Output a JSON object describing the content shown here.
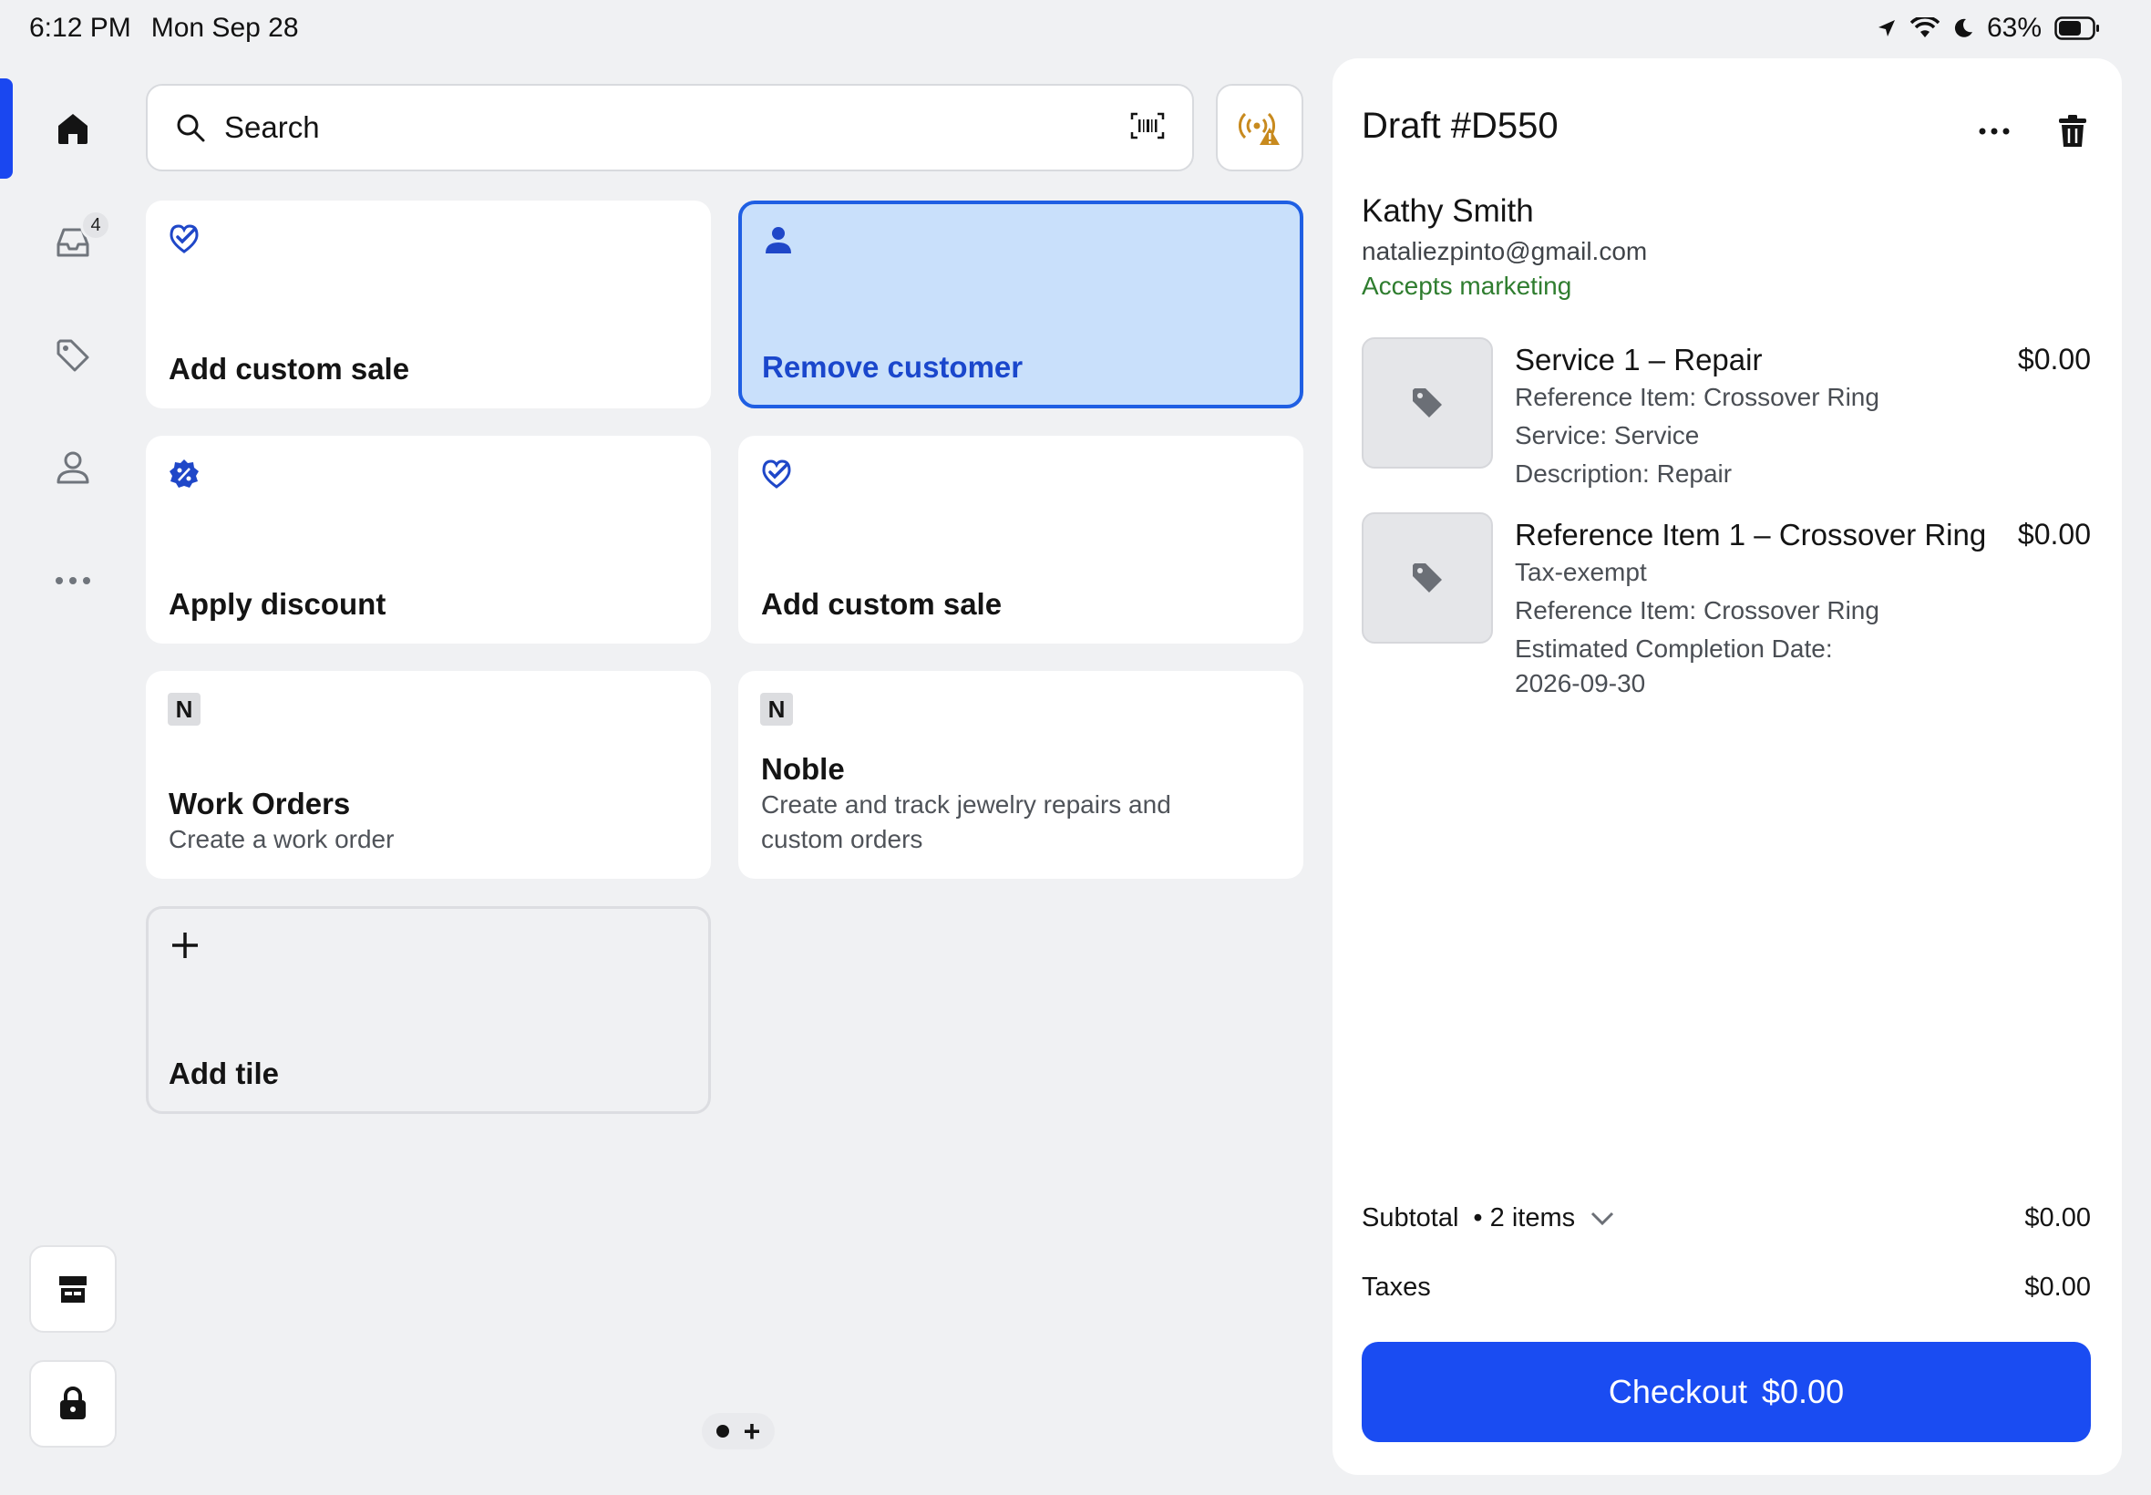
{
  "status": {
    "time": "6:12 PM",
    "date": "Mon Sep 28",
    "battery": "63%"
  },
  "nav": {
    "inbox_badge": "4"
  },
  "search": {
    "placeholder": "Search"
  },
  "tiles": {
    "t1": {
      "title": "Add custom sale"
    },
    "t2": {
      "title": "Remove customer"
    },
    "t3": {
      "title": "Apply discount"
    },
    "t4": {
      "title": "Add custom sale"
    },
    "t5": {
      "badge": "N",
      "title": "Work Orders",
      "subtitle": "Create a work order"
    },
    "t6": {
      "badge": "N",
      "title": "Noble",
      "subtitle": "Create and track jewelry repairs and custom orders"
    },
    "t7": {
      "title": "Add tile"
    }
  },
  "pager": {
    "add": "+"
  },
  "draft": {
    "title": "Draft #D550",
    "customer": {
      "name": "Kathy Smith",
      "email": "nataliezpinto@gmail.com",
      "marketing": "Accepts marketing"
    },
    "items": [
      {
        "name": "Service 1 – Repair",
        "price": "$0.00",
        "details": [
          "Reference Item: Crossover Ring",
          "Service: Service",
          "Description: Repair"
        ]
      },
      {
        "name": "Reference Item 1 – Crossover Ring",
        "price": "$0.00",
        "details": [
          "Tax-exempt",
          "Reference Item: Crossover Ring",
          "Estimated Completion Date:",
          "2026-09-30"
        ]
      }
    ],
    "subtotal": {
      "label": "Subtotal",
      "count": "• 2 items",
      "amount": "$0.00"
    },
    "taxes": {
      "label": "Taxes",
      "amount": "$0.00"
    },
    "checkout": {
      "label": "Checkout",
      "amount": "$0.00"
    }
  },
  "colors": {
    "accent": "#1a4cf2",
    "selected_tile": "#c9e0fb",
    "marketing_green": "#2f7d2f",
    "warning": "#c88a1e"
  },
  "icons": [
    "home-icon",
    "inbox-icon",
    "tag-icon",
    "person-icon",
    "more-icon",
    "store-icon",
    "lock-icon",
    "search-icon",
    "barcode-icon",
    "card-reader-warning-icon",
    "trash-icon"
  ]
}
